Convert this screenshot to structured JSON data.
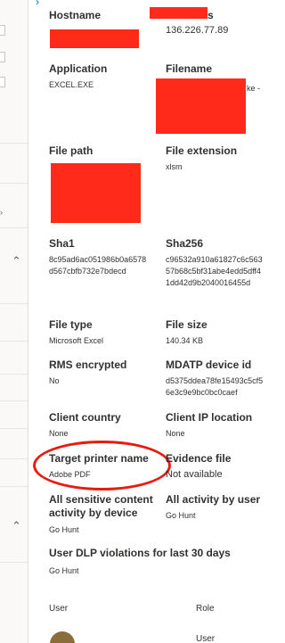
{
  "left": {
    "chevrons": [
      "⌃",
      "⌃",
      "⌃"
    ],
    "small_chevron": "›"
  },
  "top_chevron": "›",
  "fields": {
    "hostname": {
      "label": "Hostname",
      "value": ""
    },
    "ip_suffix": "s",
    "ip_address": {
      "label": "",
      "value": "136.226.77.89"
    },
    "application": {
      "label": "Application",
      "value": "EXCEL.EXE"
    },
    "filename": {
      "label": "Filename",
      "value": "ke -"
    },
    "file_path": {
      "label": "File path",
      "value": ""
    },
    "file_extension": {
      "label": "File extension",
      "value": "xlsm"
    },
    "sha1": {
      "label": "Sha1",
      "value": "8c95ad6ac051986b0a6578d567cbfb732e7bdecd"
    },
    "sha256": {
      "label": "Sha256",
      "value": "c96532a910a61827c6c56357b68c5bf31abe4edd5dff41dd42d9b2040016455d"
    },
    "file_type": {
      "label": "File type",
      "value": "Microsoft Excel"
    },
    "file_size": {
      "label": "File size",
      "value": "140.34 KB"
    },
    "rms_encrypted": {
      "label": "RMS encrypted",
      "value": "No"
    },
    "mdatp_device_id": {
      "label": "MDATP device id",
      "value": "d5375ddea78fe15493c5cf56e3c9e9bc0bc0caef"
    },
    "client_country": {
      "label": "Client country",
      "value": "None"
    },
    "client_ip_location": {
      "label": "Client IP location",
      "value": "None"
    },
    "target_printer_name": {
      "label": "Target printer name",
      "value": "Adobe PDF"
    },
    "evidence_file": {
      "label": "Evidence file",
      "value": "Not available"
    },
    "all_sensitive_by_device": {
      "label_line1": "All sensitive content",
      "label_line2": "activity by device",
      "value": "Go Hunt"
    },
    "all_activity_by_user": {
      "label": "All activity by user",
      "value": "Go Hunt"
    },
    "user_dlp_violations": {
      "label": "User DLP violations for last 30 days",
      "value": "Go Hunt"
    }
  },
  "table": {
    "col_user": "User",
    "col_role": "Role",
    "row_role": "User"
  },
  "colors": {
    "redaction": "#ff2a1a",
    "annotation": "#e81b10"
  }
}
